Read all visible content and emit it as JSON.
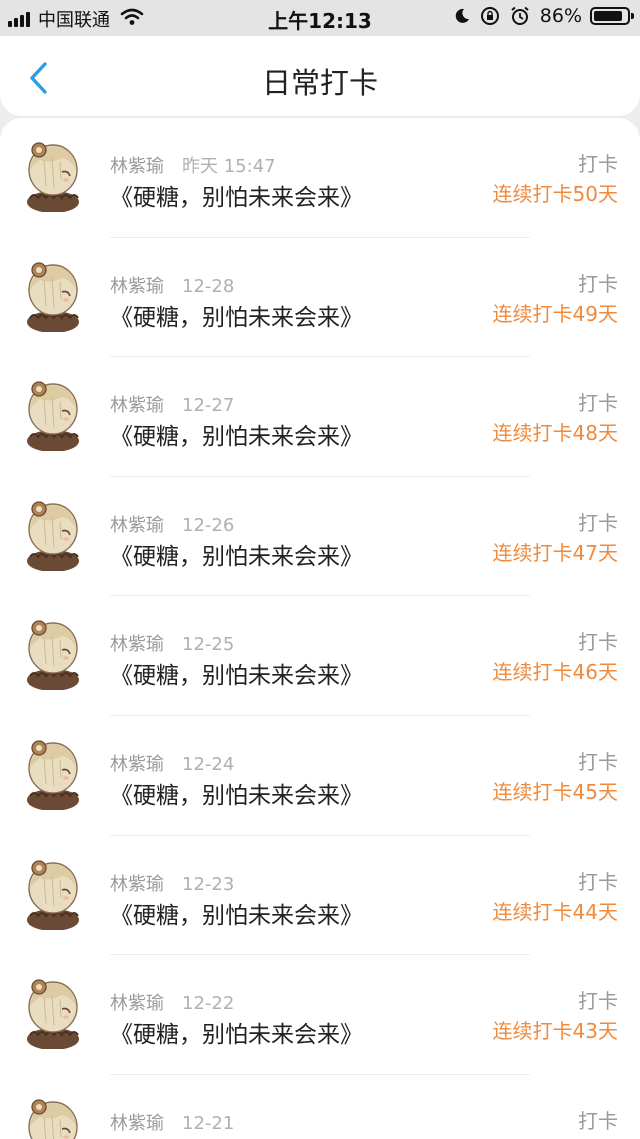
{
  "status_bar": {
    "carrier": "中国联通",
    "time": "上午12:13",
    "battery_percent": "86%",
    "battery_level": 0.86,
    "icons": [
      "signal-icon",
      "wifi-icon",
      "moon-icon",
      "rotation-lock-icon",
      "alarm-icon",
      "battery-icon"
    ]
  },
  "header": {
    "title": "日常打卡",
    "back_icon": "chevron-left-icon",
    "accent_color": "#2f9ae8"
  },
  "colors": {
    "streak": "#f08a3c"
  },
  "records": [
    {
      "user": "林紫瑜",
      "date": "昨天 15:47",
      "book": "《硬糖，别怕未来会来》",
      "tag": "打卡",
      "streak": "连续打卡50天"
    },
    {
      "user": "林紫瑜",
      "date": "12-28",
      "book": "《硬糖，别怕未来会来》",
      "tag": "打卡",
      "streak": "连续打卡49天"
    },
    {
      "user": "林紫瑜",
      "date": "12-27",
      "book": "《硬糖，别怕未来会来》",
      "tag": "打卡",
      "streak": "连续打卡48天"
    },
    {
      "user": "林紫瑜",
      "date": "12-26",
      "book": "《硬糖，别怕未来会来》",
      "tag": "打卡",
      "streak": "连续打卡47天"
    },
    {
      "user": "林紫瑜",
      "date": "12-25",
      "book": "《硬糖，别怕未来会来》",
      "tag": "打卡",
      "streak": "连续打卡46天"
    },
    {
      "user": "林紫瑜",
      "date": "12-24",
      "book": "《硬糖，别怕未来会来》",
      "tag": "打卡",
      "streak": "连续打卡45天"
    },
    {
      "user": "林紫瑜",
      "date": "12-23",
      "book": "《硬糖，别怕未来会来》",
      "tag": "打卡",
      "streak": "连续打卡44天"
    },
    {
      "user": "林紫瑜",
      "date": "12-22",
      "book": "《硬糖，别怕未来会来》",
      "tag": "打卡",
      "streak": "连续打卡43天"
    },
    {
      "user": "林紫瑜",
      "date": "12-21",
      "book": "",
      "tag": "打卡",
      "streak": ""
    }
  ]
}
